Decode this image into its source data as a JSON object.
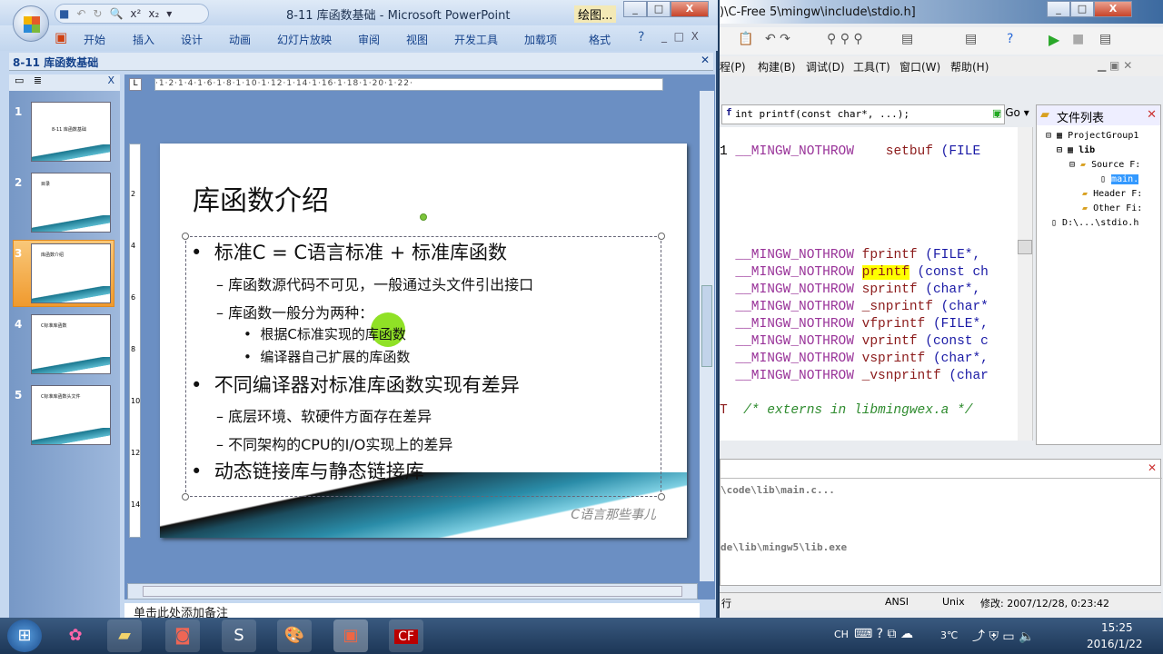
{
  "ppt": {
    "title": "8-11 库函数基础 - Microsoft PowerPoint",
    "context_tab": "绘图...",
    "qat": [
      "save",
      "undo",
      "redo",
      "print-preview",
      "x²",
      "x₂",
      "▾"
    ],
    "ribbon_tabs": [
      "开始",
      "插入",
      "设计",
      "动画",
      "幻灯片放映",
      "审阅",
      "视图",
      "开发工具",
      "加载项",
      "格式"
    ],
    "doc_tab": "8-11 库函数基础",
    "ruler": "·1·2·1·4·1·6·1·8·1·10·1·12·1·14·1·16·1·18·1·20·1·22·",
    "vruler": [
      "2",
      "4",
      "6",
      "8",
      "10",
      "12",
      "14"
    ],
    "thumbnails": [
      {
        "num": "1",
        "title": "8-11 库函数基础"
      },
      {
        "num": "2",
        "title": "目录"
      },
      {
        "num": "3",
        "title": "库函数介绍"
      },
      {
        "num": "4",
        "title": "C标准库函数"
      },
      {
        "num": "5",
        "title": "C标准库函数头文件"
      }
    ],
    "selected_slide": 3,
    "slide": {
      "title": "库函数介绍",
      "bullets": [
        {
          "level": 1,
          "text": "标准C = C语言标准 + 标准库函数"
        },
        {
          "level": 2,
          "text": "– 库函数源代码不可见，一般通过头文件引出接口"
        },
        {
          "level": 2,
          "text": "– 库函数一般分为两种："
        },
        {
          "level": 3,
          "text": "根据C标准实现的库函数"
        },
        {
          "level": 3,
          "text": "编译器自己扩展的库函数"
        },
        {
          "level": 1,
          "text": "不同编译器对标准库函数实现有差异"
        },
        {
          "level": 2,
          "text": "– 底层环境、软硬件方面存在差异"
        },
        {
          "level": 2,
          "text": "– 不同架构的CPU的I/O实现上的差异"
        },
        {
          "level": 1,
          "text": "动态链接库与静态链接库"
        }
      ],
      "watermark": "C语言那些事儿"
    },
    "notes_placeholder": "单击此处添加备注"
  },
  "cfree": {
    "title": ")\\C-Free 5\\mingw\\include\\stdio.h]",
    "menu": [
      "程(P)",
      "构建(B)",
      "调试(D)",
      "工具(T)",
      "窗口(W)",
      "帮助(H)"
    ],
    "func_signature": "int printf(const char*, ...);",
    "go_label": "Go",
    "code": [
      {
        "pre": "1 ",
        "kw": "__MINGW_NOTHROW",
        "fn": "    setbuf",
        "rest": " (FILE"
      },
      {
        "pre": "  ",
        "kw": "__MINGW_NOTHROW",
        "fn": " fprintf",
        "rest": " (FILE*,"
      },
      {
        "pre": "  ",
        "kw": "__MINGW_NOTHROW",
        "fn": " printf",
        "rest": " (const ch"
      },
      {
        "pre": "  ",
        "kw": "__MINGW_NOTHROW",
        "fn": " sprintf",
        "rest": " (char*,"
      },
      {
        "pre": "  ",
        "kw": "__MINGW_NOTHROW",
        "fn": " _snprintf",
        "rest": " (char*"
      },
      {
        "pre": "  ",
        "kw": "__MINGW_NOTHROW",
        "fn": " vfprintf",
        "rest": " (FILE*,"
      },
      {
        "pre": "  ",
        "kw": "__MINGW_NOTHROW",
        "fn": " vprintf",
        "rest": " (const c"
      },
      {
        "pre": "  ",
        "kw": "__MINGW_NOTHROW",
        "fn": " vsprintf",
        "rest": " (char*,"
      },
      {
        "pre": "  ",
        "kw": "__MINGW_NOTHROW",
        "fn": " _vsnprintf",
        "rest": " (char"
      }
    ],
    "comment_line": {
      "pre": "T",
      "text": "  /* externs in libmingwex.a */"
    },
    "file_list": {
      "title": "文件列表",
      "items": [
        "ProjectGroup1",
        "lib",
        "Source F:",
        "main.",
        "Header F:",
        "Other Fi:",
        "D:\\...\\stdio.h"
      ]
    },
    "output": [
      "\\code\\lib\\main.c...",
      "de\\lib\\mingw5\\lib.exe"
    ],
    "status": {
      "line": "行",
      "encoding": "ANSI",
      "eol": "Unix",
      "modified": "修改: 2007/12/28, 0:23:42"
    }
  },
  "taskbar": {
    "tray_lang": "CH",
    "temperature": "3℃",
    "time": "15:25",
    "date": "2016/1/22"
  }
}
